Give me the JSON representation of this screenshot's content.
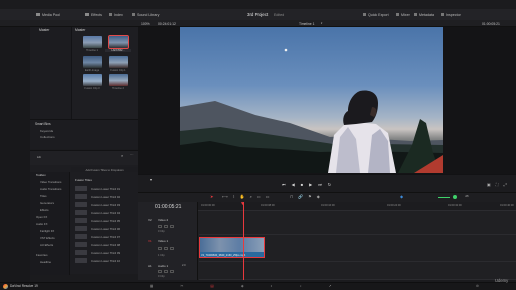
{
  "menubar": {
    "media_pool": "Media Pool",
    "effects": "Effects",
    "index": "Index",
    "sound_library": "Sound Library",
    "project_title": "3rd Project",
    "project_status": "Edited",
    "quick_export": "Quick Export",
    "mixer": "Mixer",
    "metadata": "Metadata",
    "inspector": "Inspector"
  },
  "toolbar": {
    "zoom": "100%",
    "source_timecode": "00:24:01:12",
    "timeline_name": "Timeline 1",
    "record_timecode": "01:00:05:21"
  },
  "media_pool": {
    "master": "Master",
    "master_bin": "Master",
    "clips": [
      {
        "label": "Timeline 1"
      },
      {
        "label": "LAFKS52..."
      },
      {
        "label": "Earth-Image"
      },
      {
        "label": "Fusion Clip 1"
      },
      {
        "label": "Fusion Clip 3"
      },
      {
        "label": "Timeline 2"
      }
    ]
  },
  "smart_bins": {
    "title": "Smart Bins",
    "items": [
      "Keywords",
      "Collections"
    ]
  },
  "effects": {
    "search_label": "Add Fusion Titles to Dropdown",
    "toolbox": "Toolbox",
    "list_header": "Fusion Titles",
    "tree": [
      "Toolbox",
      "Video Transitions",
      "Audio Transitions",
      "Titles",
      "Generators",
      "Effects",
      "Open FX",
      "Audio FX",
      "Fairlight FX",
      "VST Effects",
      "AU Effects",
      "Favorites",
      "Headline"
    ],
    "items": [
      "Custom Lower Third 01",
      "Custom Lower Third 02",
      "Custom Lower Third 03",
      "Custom Lower Third 04",
      "Custom Lower Third 05",
      "Custom Lower Third 06",
      "Custom Lower Third 07",
      "Custom Lower Third 08",
      "Custom Lower Third 09",
      "Custom Lower Third 10"
    ]
  },
  "timeline": {
    "timecode": "01:00:05:21",
    "ruler": [
      "01:00:00:00",
      "01:00:08:00",
      "01:00:16:00",
      "01:00:24:00",
      "01:00:32:00",
      "01:00:40:00"
    ],
    "tracks": [
      {
        "id": "V2",
        "name": "Video 2",
        "clips_label": "0 Clip"
      },
      {
        "id": "V1",
        "name": "Video 1",
        "clips_label": "1 Clip"
      },
      {
        "id": "A1",
        "name": "Audio 1",
        "level": "2.0",
        "clips_label": "0 Clip"
      }
    ],
    "clip_name": "V1_70493630_3840_2160_25fps.mp4"
  },
  "pagebar": {
    "app_name": "DaVinci Resolve 19"
  },
  "watermark": "Udemy",
  "colors": {
    "accent": "#e8393d",
    "clip": "#2b6a9e",
    "audio_level": "#3fd16a"
  }
}
